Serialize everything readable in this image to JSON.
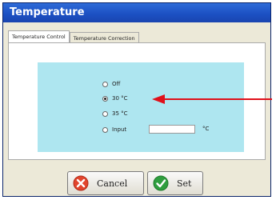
{
  "window": {
    "title": "Temperature"
  },
  "tabs": [
    {
      "label": "Temperature Control"
    },
    {
      "label": "Temperature Correction"
    }
  ],
  "options": [
    {
      "label": "Off",
      "selected": false
    },
    {
      "label": "30 °C",
      "selected": true
    },
    {
      "label": "35 °C",
      "selected": false
    },
    {
      "label": "Input",
      "selected": false
    }
  ],
  "input": {
    "value": "",
    "unit": "°C"
  },
  "buttons": {
    "cancel_label": "Cancel",
    "set_label": "Set"
  },
  "colors": {
    "title_bar": "#1b4fc2",
    "panel_bg": "#aee6f0",
    "arrow": "#e0101a",
    "cancel_icon": "#e2452d",
    "set_icon": "#2f9e3e"
  }
}
